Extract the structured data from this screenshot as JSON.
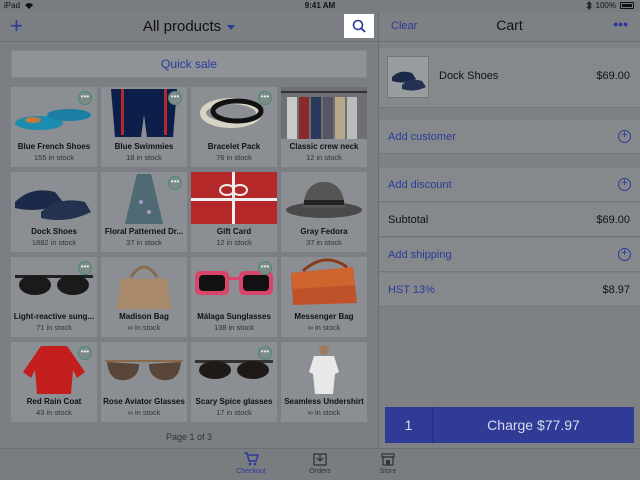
{
  "status_bar": {
    "device": "iPad",
    "time": "9:41 AM",
    "battery": "100%"
  },
  "header": {
    "title": "All products",
    "add_icon": "plus-icon",
    "search_icon": "search-icon"
  },
  "quick_sale": {
    "label": "Quick sale"
  },
  "products": [
    {
      "name": "Blue French Shoes",
      "stock": "155 in stock"
    },
    {
      "name": "Blue Swimmies",
      "stock": "18 in stock"
    },
    {
      "name": "Bracelet Pack",
      "stock": "76 in stock"
    },
    {
      "name": "Classic crew neck",
      "stock": "12 in stock"
    },
    {
      "name": "Dock Shoes",
      "stock": "1882 in stock"
    },
    {
      "name": "Floral Patterned Dr...",
      "stock": "37 in stock"
    },
    {
      "name": "Gift Card",
      "stock": "12 in stock"
    },
    {
      "name": "Gray Fedora",
      "stock": "37 in stock"
    },
    {
      "name": "Light-reactive sung...",
      "stock": "71 in stock"
    },
    {
      "name": "Madison Bag",
      "stock": "∞ in stock"
    },
    {
      "name": "Málaga Sunglasses",
      "stock": "138 in stock"
    },
    {
      "name": "Messenger Bag",
      "stock": "∞ in stock"
    },
    {
      "name": "Red Rain Coat",
      "stock": "43 in stock"
    },
    {
      "name": "Rose Aviator Glasses",
      "stock": "∞ in stock"
    },
    {
      "name": "Scary Spice glasses",
      "stock": "17 in stock"
    },
    {
      "name": "Seamless Undershirt",
      "stock": "∞ in stock"
    }
  ],
  "pager": {
    "text": "Page 1 of 3"
  },
  "cart": {
    "clear_label": "Clear",
    "title": "Cart",
    "more_label": "•••",
    "item": {
      "name": "Dock Shoes",
      "price": "$69.00"
    },
    "add_customer": "Add customer",
    "add_discount": "Add discount",
    "subtotal_label": "Subtotal",
    "subtotal_value": "$69.00",
    "add_shipping": "Add shipping",
    "tax_label": "HST 13%",
    "tax_value": "$8.97",
    "quantity": "1",
    "charge_label": "Charge $77.97"
  },
  "tabs": [
    {
      "label": "Checkout",
      "icon": "cart-icon",
      "active": true
    },
    {
      "label": "Orders",
      "icon": "orders-icon",
      "active": false
    },
    {
      "label": "Store",
      "icon": "store-icon",
      "active": false
    }
  ],
  "colors": {
    "accent": "#2a3a9a",
    "more_badge": "#4a8a78"
  }
}
